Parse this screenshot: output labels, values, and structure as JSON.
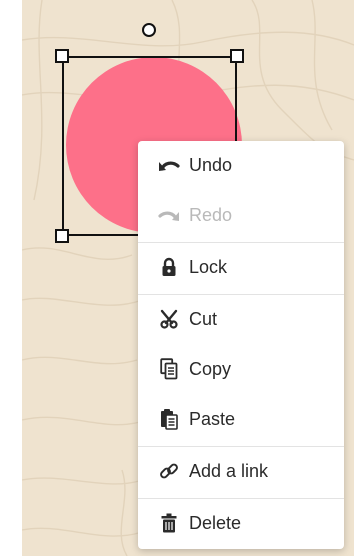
{
  "canvas": {
    "background_color": "#efe3cf",
    "grain_color": "#e2d3bb"
  },
  "shape": {
    "type": "circle",
    "fill_color": "#fd7089",
    "selected": true
  },
  "context_menu": {
    "items": [
      {
        "label": "Undo",
        "icon": "undo-icon",
        "enabled": true
      },
      {
        "label": "Redo",
        "icon": "redo-icon",
        "enabled": false
      },
      {
        "label": "Lock",
        "icon": "lock-icon",
        "enabled": true
      },
      {
        "label": "Cut",
        "icon": "scissors-icon",
        "enabled": true
      },
      {
        "label": "Copy",
        "icon": "copy-icon",
        "enabled": true
      },
      {
        "label": "Paste",
        "icon": "paste-icon",
        "enabled": true
      },
      {
        "label": "Add a link",
        "icon": "link-icon",
        "enabled": true
      },
      {
        "label": "Delete",
        "icon": "trash-icon",
        "enabled": true
      }
    ],
    "text_color": "#2b2b2b",
    "disabled_color": "#b9b9b9"
  }
}
